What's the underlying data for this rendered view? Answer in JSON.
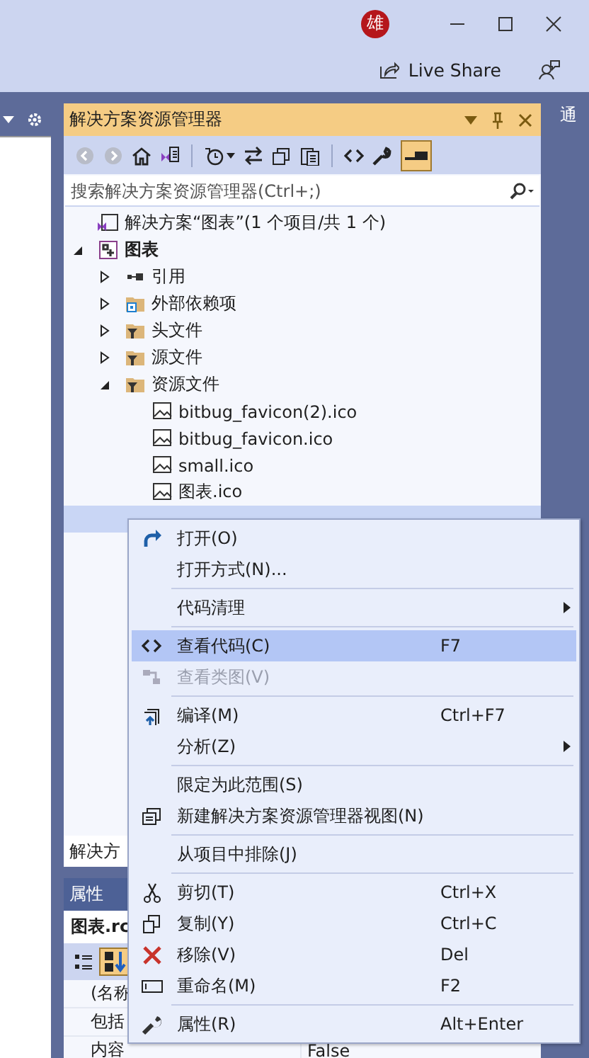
{
  "title_bar": {
    "avatar": "雄",
    "live_share": "Live Share"
  },
  "solution_explorer": {
    "title": "解决方案资源管理器",
    "search": {
      "placeholder": "搜索解决方案资源管理器(Ctrl+;)"
    },
    "tree": [
      {
        "label": "解决方案“图表”(1 个项目/共 1 个)",
        "kind": "solution",
        "selected": false,
        "children": [
          {
            "label": "图表",
            "kind": "project",
            "expanded": true,
            "selected": false,
            "children": [
              {
                "label": "引用",
                "kind": "references",
                "expanded": false,
                "selected": false
              },
              {
                "label": "外部依赖项",
                "kind": "dependencies",
                "expanded": false,
                "selected": false
              },
              {
                "label": "头文件",
                "kind": "filter",
                "expanded": false,
                "selected": false
              },
              {
                "label": "源文件",
                "kind": "filter",
                "expanded": false,
                "selected": false
              },
              {
                "label": "资源文件",
                "kind": "filter",
                "expanded": true,
                "selected": false,
                "children": [
                  {
                    "label": "bitbug_favicon(2).ico",
                    "kind": "image",
                    "selected": false
                  },
                  {
                    "label": "bitbug_favicon.ico",
                    "kind": "image",
                    "selected": false
                  },
                  {
                    "label": "small.ico",
                    "kind": "image",
                    "selected": false
                  },
                  {
                    "label": "图表.ico",
                    "kind": "image",
                    "selected": false
                  },
                  {
                    "kind": "resource",
                    "selected": true
                  }
                ]
              }
            ]
          }
        ]
      }
    ],
    "bottom_tab": "解决方"
  },
  "side_strip": {
    "label": "通"
  },
  "properties": {
    "title": "属性",
    "object": "图表.rc",
    "rows": [
      {
        "name": "(名称"
      },
      {
        "name": "包括"
      },
      {
        "name": "内容",
        "value": "False"
      }
    ]
  },
  "context_menu": [
    {
      "kind": "item",
      "label": "打开(O)",
      "selected": false
    },
    {
      "kind": "item",
      "label": "打开方式(N)...",
      "selected": false
    },
    {
      "kind": "separator"
    },
    {
      "kind": "item",
      "label": "代码清理",
      "submenu": true,
      "selected": false
    },
    {
      "kind": "separator"
    },
    {
      "kind": "item",
      "label": "查看代码(C)",
      "shortcut": "F7",
      "selected": true
    },
    {
      "kind": "item",
      "label": "查看类图(V)",
      "disabled": true,
      "selected": false
    },
    {
      "kind": "separator"
    },
    {
      "kind": "item",
      "label": "编译(M)",
      "shortcut": "Ctrl+F7",
      "selected": false
    },
    {
      "kind": "item",
      "label": "分析(Z)",
      "submenu": true,
      "selected": false
    },
    {
      "kind": "separator"
    },
    {
      "kind": "item",
      "label": "限定为此范围(S)",
      "selected": false
    },
    {
      "kind": "item",
      "label": "新建解决方案资源管理器视图(N)",
      "selected": false
    },
    {
      "kind": "separator"
    },
    {
      "kind": "item",
      "label": "从项目中排除(J)",
      "selected": false
    },
    {
      "kind": "separator"
    },
    {
      "kind": "item",
      "label": "剪切(T)",
      "shortcut": "Ctrl+X",
      "selected": false
    },
    {
      "kind": "item",
      "label": "复制(Y)",
      "shortcut": "Ctrl+C",
      "selected": false
    },
    {
      "kind": "item",
      "label": "移除(V)",
      "shortcut": "Del",
      "selected": false
    },
    {
      "kind": "item",
      "label": "重命名(M)",
      "shortcut": "F2",
      "selected": false
    },
    {
      "kind": "separator"
    },
    {
      "kind": "item",
      "label": "属性(R)",
      "shortcut": "Alt+Enter",
      "selected": false
    }
  ]
}
